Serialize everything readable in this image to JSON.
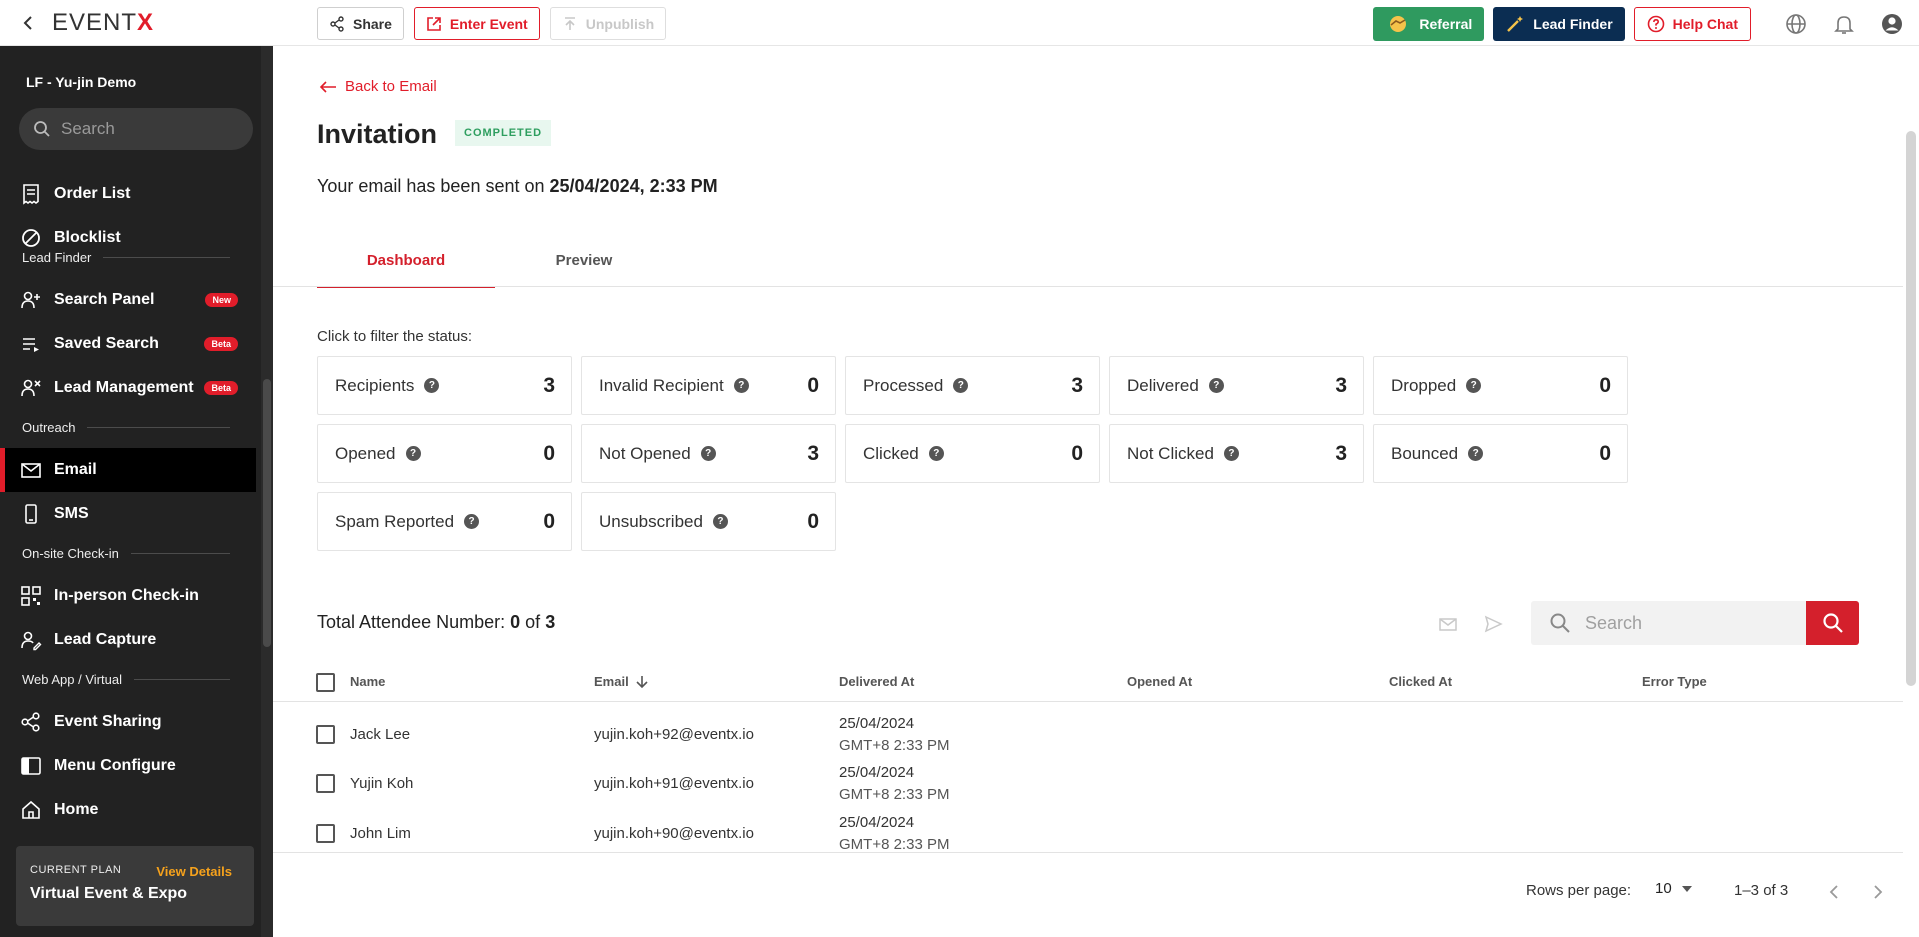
{
  "topbar": {
    "logo_main": "EVENT",
    "logo_x": "X",
    "buttons": {
      "share": "Share",
      "enter_event": "Enter Event",
      "unpublish": "Unpublish"
    },
    "right": {
      "referral": "Referral",
      "lead_finder": "Lead Finder",
      "help_chat": "Help Chat"
    }
  },
  "sidebar": {
    "event_name": "LF - Yu-jin Demo",
    "search_placeholder": "Search",
    "items": {
      "order_list": "Order List",
      "blocklist": "Blocklist",
      "search_panel": "Search Panel",
      "search_panel_badge": "New",
      "saved_search": "Saved Search",
      "saved_search_badge": "Beta",
      "lead_management": "Lead Management",
      "lead_management_badge": "Beta",
      "email": "Email",
      "sms": "SMS",
      "in_person_checkin": "In-person Check-in",
      "lead_capture": "Lead Capture",
      "event_sharing": "Event Sharing",
      "menu_configure": "Menu Configure",
      "home": "Home"
    },
    "sections": {
      "lead_finder": "Lead Finder",
      "outreach": "Outreach",
      "onsite": "On-site Check-in",
      "webapp": "Web App / Virtual"
    },
    "plan": {
      "label": "CURRENT PLAN",
      "link": "View Details",
      "name": "Virtual Event & Expo"
    }
  },
  "main": {
    "back_link": "Back to Email",
    "title": "Invitation",
    "status": "COMPLETED",
    "sent_prefix": "Your email has been sent on",
    "sent_at": "25/04/2024, 2:33 PM",
    "tabs": {
      "dashboard": "Dashboard",
      "preview": "Preview"
    },
    "filter_hint": "Click to filter the status:",
    "stats": [
      {
        "label": "Recipients",
        "value": "3"
      },
      {
        "label": "Invalid Recipient",
        "value": "0"
      },
      {
        "label": "Processed",
        "value": "3"
      },
      {
        "label": "Delivered",
        "value": "3"
      },
      {
        "label": "Dropped",
        "value": "0"
      },
      {
        "label": "Opened",
        "value": "0"
      },
      {
        "label": "Not Opened",
        "value": "3"
      },
      {
        "label": "Clicked",
        "value": "0"
      },
      {
        "label": "Not Clicked",
        "value": "3"
      },
      {
        "label": "Bounced",
        "value": "0"
      },
      {
        "label": "Spam Reported",
        "value": "0"
      },
      {
        "label": "Unsubscribed",
        "value": "0"
      }
    ],
    "help_glyph": "?",
    "total": {
      "prefix": "Total Attendee Number:",
      "selected": "0",
      "of": "of",
      "count": "3"
    },
    "search_placeholder": "Search",
    "table": {
      "headers": {
        "name": "Name",
        "email": "Email",
        "delivered": "Delivered At",
        "opened": "Opened At",
        "clicked": "Clicked At",
        "error": "Error Type"
      },
      "rows": [
        {
          "name": "Jack Lee",
          "email": "yujin.koh+92@eventx.io",
          "delivered_date": "25/04/2024",
          "delivered_time": "GMT+8 2:33 PM"
        },
        {
          "name": "Yujin Koh",
          "email": "yujin.koh+91@eventx.io",
          "delivered_date": "25/04/2024",
          "delivered_time": "GMT+8 2:33 PM"
        },
        {
          "name": "John Lim",
          "email": "yujin.koh+90@eventx.io",
          "delivered_date": "25/04/2024",
          "delivered_time": "GMT+8 2:33 PM"
        }
      ]
    },
    "pagination": {
      "rows_label": "Rows per page:",
      "rows_value": "10",
      "range": "1–3 of 3"
    }
  },
  "colors": {
    "brand_red": "#e11d2a",
    "referral_green": "#2f9a5f",
    "lead_finder_navy": "#0b2d52",
    "sidebar_bg": "#222222",
    "plan_link": "#f6a21c"
  }
}
